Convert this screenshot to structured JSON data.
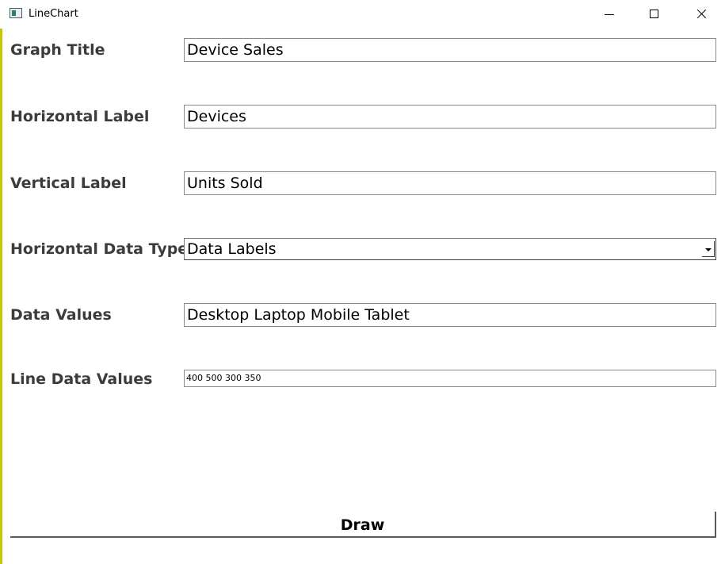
{
  "window": {
    "title": "LineChart",
    "icon": "app-icon"
  },
  "form": {
    "graph_title": {
      "label": "Graph Title",
      "value": "Device Sales"
    },
    "horizontal_label": {
      "label": "Horizontal Label",
      "value": "Devices"
    },
    "vertical_label": {
      "label": "Vertical Label",
      "value": "Units Sold"
    },
    "horizontal_data_type": {
      "label": "Horizontal Data Type",
      "selected": "Data Labels"
    },
    "data_values": {
      "label": "Data Values",
      "value": "Desktop Laptop Mobile Tablet"
    },
    "line_data_values": {
      "label": "Line Data Values",
      "value": "400 500 300 350"
    }
  },
  "actions": {
    "draw_label": "Draw"
  }
}
